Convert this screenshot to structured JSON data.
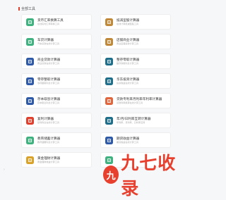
{
  "section": {
    "title": "全部工具"
  },
  "tools": [
    {
      "title": "货币汇率换算工具",
      "subtitle": "在线实时汇率转换工具",
      "icon": "currency-icon",
      "color": "#3fb27f"
    },
    {
      "title": "抵减型股计算器",
      "subtitle": "在线计算抵减型股工具",
      "icon": "stamp-icon",
      "color": "#c0893a"
    },
    {
      "title": "车贷计算器",
      "subtitle": "汽车贷款在线计算工具",
      "icon": "car-icon",
      "color": "#3fb27f"
    },
    {
      "title": "店铺商业计算器",
      "subtitle": "商业店铺贷款计算工具",
      "icon": "shop-icon",
      "color": "#c0893a"
    },
    {
      "title": "商业贷款计算器",
      "subtitle": "商业贷款在线计算工具",
      "icon": "loan-icon",
      "color": "#2f5aa8"
    },
    {
      "title": "整存零取计算器",
      "subtitle": "整存零取利息计算工具",
      "icon": "deposit-icon",
      "color": "#1f6f8b"
    },
    {
      "title": "零存整取计算器",
      "subtitle": "零存整取利息计算工具",
      "icon": "savings-icon",
      "color": "#2f5aa8"
    },
    {
      "title": "华东投资计算器",
      "subtitle": "投资收益在线计算工具",
      "icon": "chart-icon",
      "color": "#1f6f8b"
    },
    {
      "title": "存本取息计算器",
      "subtitle": "存本取息利息计算工具",
      "icon": "interest-icon",
      "color": "#2f5aa8"
    },
    {
      "title": "贷款专利率月利率年利率计算器",
      "subtitle": "贷款利率换算在线计算工具",
      "icon": "percent-icon",
      "color": "#e0663e"
    },
    {
      "title": "复利计算器",
      "subtitle": "复利利息在线计算工具",
      "icon": "compound-icon",
      "color": "#e0412e"
    },
    {
      "title": "年/月/日利率互转计算器",
      "subtitle": "年利率、月利率、日利率互转",
      "icon": "convert-icon",
      "color": "#1f6f8b"
    },
    {
      "title": "教育储蓄计算器",
      "subtitle": "教育储蓄利息计算工具",
      "icon": "education-icon",
      "color": "#3fb27f"
    },
    {
      "title": "期货收益计算器",
      "subtitle": "期货收益在线计算工具",
      "icon": "futures-icon",
      "color": "#2f5aa8"
    },
    {
      "title": "黄金理财计算器",
      "subtitle": "黄金理财收益计算工具",
      "icon": "gold-icon",
      "color": "#d9a22b"
    },
    {
      "title": "",
      "subtitle": "",
      "icon": "tool-icon",
      "color": "#3fb27f"
    }
  ],
  "watermark": {
    "logo": "九",
    "text": "九七收录"
  },
  "side": {
    "arrow": "›"
  }
}
